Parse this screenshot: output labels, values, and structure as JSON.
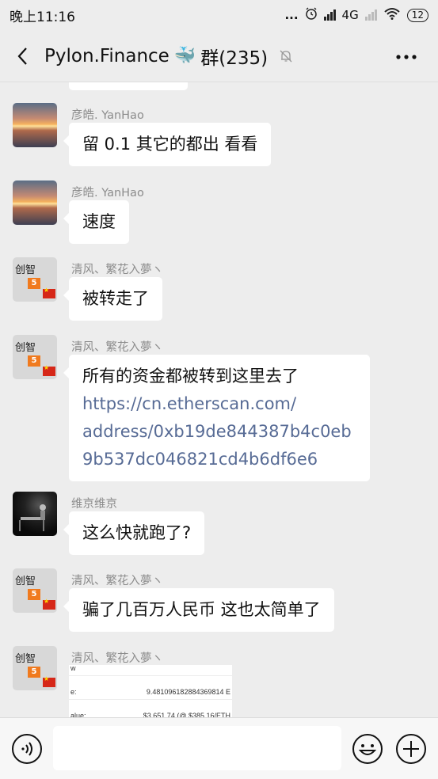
{
  "status_bar": {
    "time": "晚上11:16",
    "dots": "...",
    "network": "4G",
    "battery": "12"
  },
  "header": {
    "title": "Pylon.Finance",
    "emoji": "🐳",
    "suffix": "群(235)"
  },
  "messages": [
    {
      "sender": "彦皓. YanHao",
      "avatar": "sunset-avatar",
      "text": "留 0.1 其它的都出 看看"
    },
    {
      "sender": "彦皓. YanHao",
      "avatar": "sunset-avatar",
      "text": "速度"
    },
    {
      "sender": "清风、繁花入夢ヽ",
      "avatar": "logo-avatar",
      "text": "被转走了"
    },
    {
      "sender": "清风、繁花入夢ヽ",
      "avatar": "logo-avatar",
      "text_line1": "所有的资金都被转到这里去了",
      "link_lines": [
        "https://cn.etherscan.com/",
        "address/0xb19de844387b4c0eb",
        "9b537dc046821cd4b6df6e6"
      ]
    },
    {
      "sender": "维京维京",
      "avatar": "dark-avatar",
      "text": "这么快就跑了?"
    },
    {
      "sender": "清风、繁花入夢ヽ",
      "avatar": "logo-avatar",
      "text": "骗了几百万人民币 这也太简单了"
    },
    {
      "sender": "清风、繁花入夢ヽ",
      "avatar": "logo-avatar",
      "image_rows": [
        {
          "label": "w",
          "value": ""
        },
        {
          "label": "e:",
          "value": "9.481096182884369814 E"
        },
        {
          "label": "alue:",
          "value": "$3,651.74 (@ $385.16/ETH"
        }
      ]
    }
  ],
  "avatar_logo": {
    "text": "创智",
    "box": "5"
  }
}
